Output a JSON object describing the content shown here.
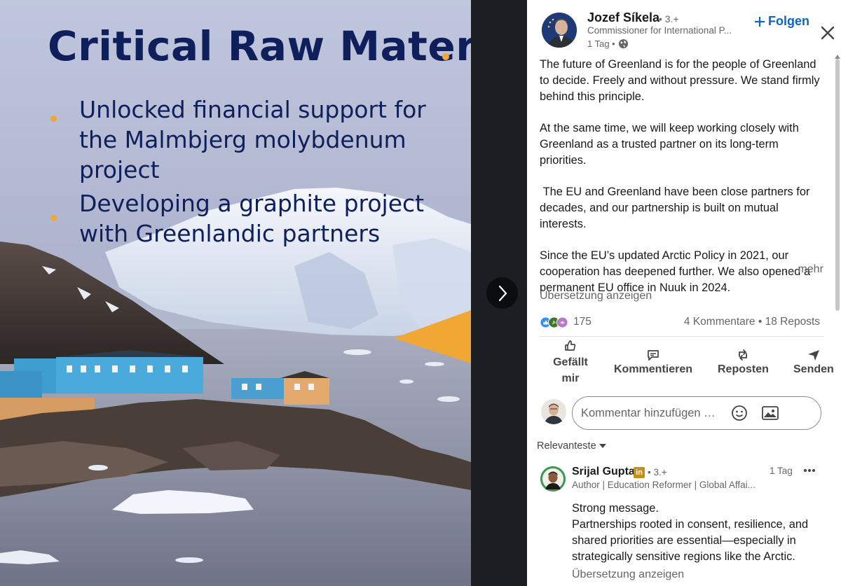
{
  "slide": {
    "title": "Critical Raw Materials",
    "bullets": [
      "Unlocked financial support for the Malmbjerg molybdenum project",
      "Developing a graphite project with Greenlandic partners"
    ],
    "accent_color": "#f0a733",
    "text_color": "#0e1f5c"
  },
  "viewer": {
    "next_icon": "chevron-right-icon"
  },
  "post": {
    "author_name": "Jozef Síkela",
    "author_degree": "• 3.+",
    "author_subtitle": "Commissioner for International P...",
    "time": "1 Tag •",
    "visibility_icon": "globe-icon",
    "follow_label": "Folgen",
    "paragraphs": [
      "The future of Greenland is for the people of Greenland to decide. Freely and without pressure. We stand firmly behind this principle.",
      "At the same time, we will keep working closely with Greenland as a trusted partner on its long-term priorities.",
      " The EU and Greenland have been close partners for decades, and our partnership is built on mutual interests.",
      "Since the EU’s updated Arctic Policy in 2021, our cooperation has deepened further. We also opened a permanent EU office in Nuuk in 2024."
    ],
    "more_label": "… mehr",
    "translate_label": "Übersetzung anzeigen",
    "reaction_count": "175",
    "comments_reposts": "4 Kommentare • 18 Reposts",
    "actions": {
      "like": "Gefällt mir",
      "comment": "Kommentieren",
      "repost": "Reposten",
      "send": "Senden"
    },
    "comment_placeholder": "Kommentar hinzufügen …",
    "sort_label": "Relevanteste",
    "link_color": "#0a66c2"
  },
  "comments": [
    {
      "name": "Srijal Gupta",
      "badge": "in",
      "degree": "• 3.+",
      "subtitle": "Author | Education Reformer | Global Affai...",
      "time": "1 Tag",
      "text": "Strong message.\nPartnerships rooted in consent, resilience, and shared priorities are essential—especially in strategically sensitive regions like the Arctic.",
      "translate_label": "Übersetzung anzeigen"
    }
  ]
}
